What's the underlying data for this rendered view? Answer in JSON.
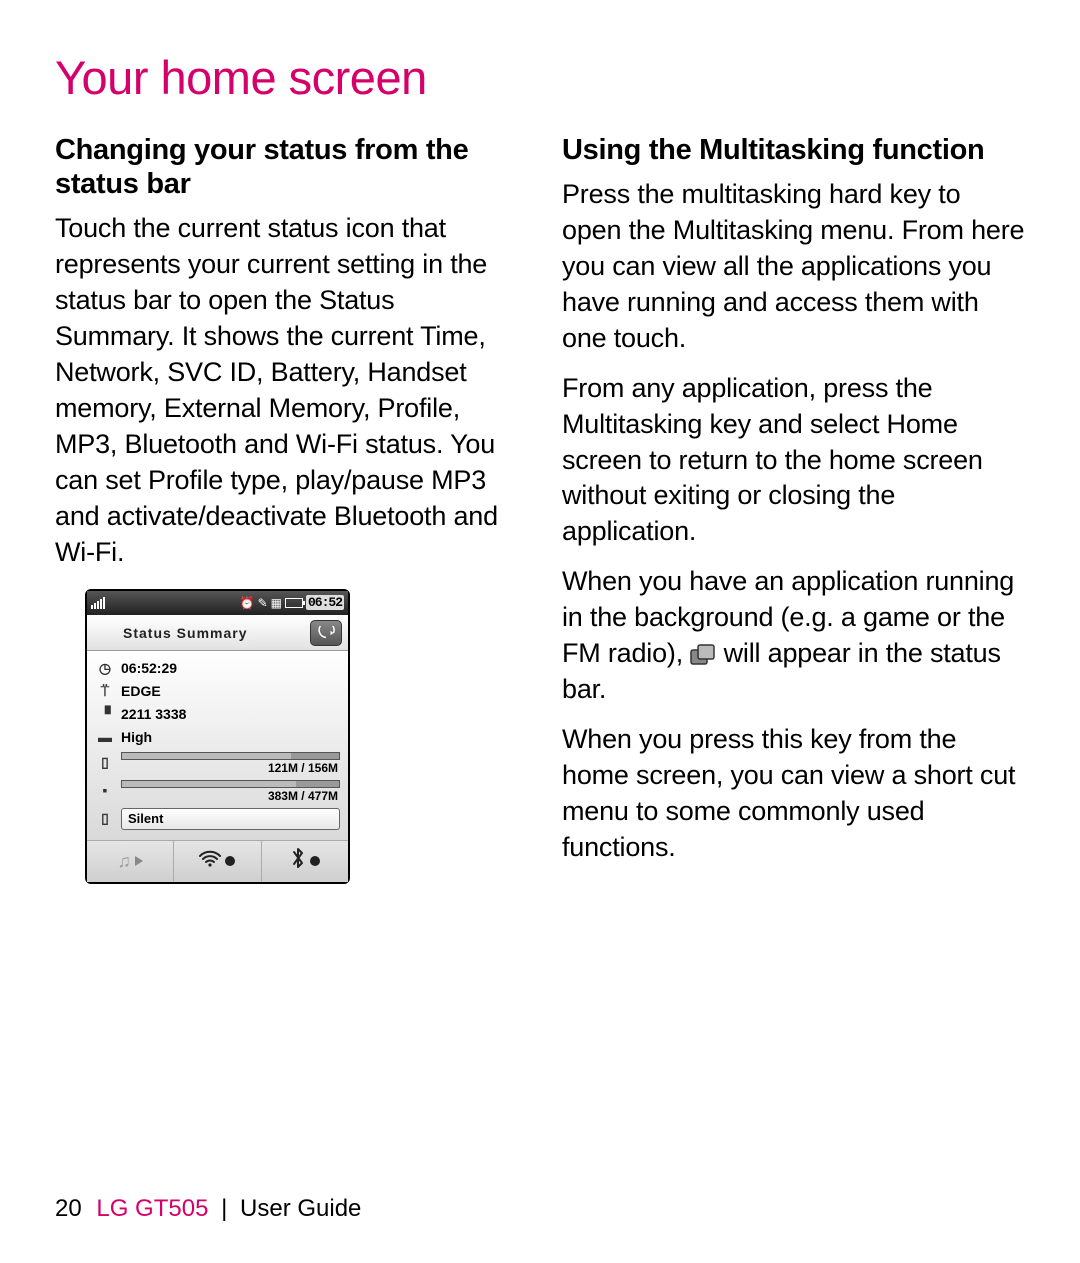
{
  "page": {
    "title": "Your home screen",
    "footer": {
      "page_number": "20",
      "model": "LG GT505",
      "separator": "|",
      "guide": "User Guide"
    }
  },
  "left": {
    "heading": "Changing your status from the status bar",
    "body": "Touch the current status icon that represents your current setting in the status bar to open the Status Summary. It shows the current Time, Network, SVC ID, Battery, Handset memory, External Memory, Profile, MP3, Bluetooth and Wi-Fi status. You can set Profile type, play/pause MP3 and activate/deactivate Bluetooth and Wi-Fi."
  },
  "right": {
    "heading": "Using the Multitasking function",
    "p1": "Press the multitasking hard key to open the Multitasking menu. From here you can view all the applications you have running and access them with one touch.",
    "p2": "From any application, press the Multitasking key and select Home screen to return to the home screen without exiting or closing the application.",
    "p3a": "When you have an application running in the background (e.g. a game or the FM radio), ",
    "p3b": " will appear in the status bar.",
    "p4": "When you press this key from the home screen, you can view a short cut menu to some commonly used functions."
  },
  "phone": {
    "status_bar_time": "06:52",
    "title": "Status Summary",
    "rows": {
      "time": {
        "value": "06:52:29"
      },
      "network": {
        "value": "EDGE"
      },
      "svc_id": {
        "value": "2211 3338"
      },
      "battery": {
        "value": "High"
      },
      "mem_internal": {
        "label": "121M / 156M",
        "pct": 78
      },
      "mem_external": {
        "label": "383M / 477M",
        "pct": 80
      },
      "profile": {
        "value": "Silent"
      }
    }
  }
}
